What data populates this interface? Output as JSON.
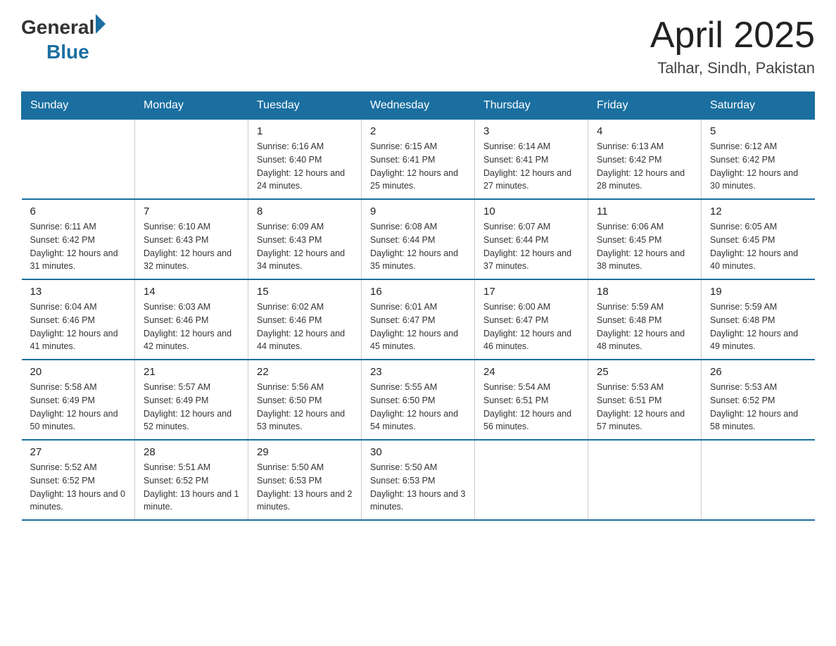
{
  "header": {
    "logo_general": "General",
    "logo_blue": "Blue",
    "title": "April 2025",
    "subtitle": "Talhar, Sindh, Pakistan"
  },
  "calendar": {
    "days_of_week": [
      "Sunday",
      "Monday",
      "Tuesday",
      "Wednesday",
      "Thursday",
      "Friday",
      "Saturday"
    ],
    "weeks": [
      [
        {
          "day": "",
          "info": ""
        },
        {
          "day": "",
          "info": ""
        },
        {
          "day": "1",
          "info": "Sunrise: 6:16 AM\nSunset: 6:40 PM\nDaylight: 12 hours\nand 24 minutes."
        },
        {
          "day": "2",
          "info": "Sunrise: 6:15 AM\nSunset: 6:41 PM\nDaylight: 12 hours\nand 25 minutes."
        },
        {
          "day": "3",
          "info": "Sunrise: 6:14 AM\nSunset: 6:41 PM\nDaylight: 12 hours\nand 27 minutes."
        },
        {
          "day": "4",
          "info": "Sunrise: 6:13 AM\nSunset: 6:42 PM\nDaylight: 12 hours\nand 28 minutes."
        },
        {
          "day": "5",
          "info": "Sunrise: 6:12 AM\nSunset: 6:42 PM\nDaylight: 12 hours\nand 30 minutes."
        }
      ],
      [
        {
          "day": "6",
          "info": "Sunrise: 6:11 AM\nSunset: 6:42 PM\nDaylight: 12 hours\nand 31 minutes."
        },
        {
          "day": "7",
          "info": "Sunrise: 6:10 AM\nSunset: 6:43 PM\nDaylight: 12 hours\nand 32 minutes."
        },
        {
          "day": "8",
          "info": "Sunrise: 6:09 AM\nSunset: 6:43 PM\nDaylight: 12 hours\nand 34 minutes."
        },
        {
          "day": "9",
          "info": "Sunrise: 6:08 AM\nSunset: 6:44 PM\nDaylight: 12 hours\nand 35 minutes."
        },
        {
          "day": "10",
          "info": "Sunrise: 6:07 AM\nSunset: 6:44 PM\nDaylight: 12 hours\nand 37 minutes."
        },
        {
          "day": "11",
          "info": "Sunrise: 6:06 AM\nSunset: 6:45 PM\nDaylight: 12 hours\nand 38 minutes."
        },
        {
          "day": "12",
          "info": "Sunrise: 6:05 AM\nSunset: 6:45 PM\nDaylight: 12 hours\nand 40 minutes."
        }
      ],
      [
        {
          "day": "13",
          "info": "Sunrise: 6:04 AM\nSunset: 6:46 PM\nDaylight: 12 hours\nand 41 minutes."
        },
        {
          "day": "14",
          "info": "Sunrise: 6:03 AM\nSunset: 6:46 PM\nDaylight: 12 hours\nand 42 minutes."
        },
        {
          "day": "15",
          "info": "Sunrise: 6:02 AM\nSunset: 6:46 PM\nDaylight: 12 hours\nand 44 minutes."
        },
        {
          "day": "16",
          "info": "Sunrise: 6:01 AM\nSunset: 6:47 PM\nDaylight: 12 hours\nand 45 minutes."
        },
        {
          "day": "17",
          "info": "Sunrise: 6:00 AM\nSunset: 6:47 PM\nDaylight: 12 hours\nand 46 minutes."
        },
        {
          "day": "18",
          "info": "Sunrise: 5:59 AM\nSunset: 6:48 PM\nDaylight: 12 hours\nand 48 minutes."
        },
        {
          "day": "19",
          "info": "Sunrise: 5:59 AM\nSunset: 6:48 PM\nDaylight: 12 hours\nand 49 minutes."
        }
      ],
      [
        {
          "day": "20",
          "info": "Sunrise: 5:58 AM\nSunset: 6:49 PM\nDaylight: 12 hours\nand 50 minutes."
        },
        {
          "day": "21",
          "info": "Sunrise: 5:57 AM\nSunset: 6:49 PM\nDaylight: 12 hours\nand 52 minutes."
        },
        {
          "day": "22",
          "info": "Sunrise: 5:56 AM\nSunset: 6:50 PM\nDaylight: 12 hours\nand 53 minutes."
        },
        {
          "day": "23",
          "info": "Sunrise: 5:55 AM\nSunset: 6:50 PM\nDaylight: 12 hours\nand 54 minutes."
        },
        {
          "day": "24",
          "info": "Sunrise: 5:54 AM\nSunset: 6:51 PM\nDaylight: 12 hours\nand 56 minutes."
        },
        {
          "day": "25",
          "info": "Sunrise: 5:53 AM\nSunset: 6:51 PM\nDaylight: 12 hours\nand 57 minutes."
        },
        {
          "day": "26",
          "info": "Sunrise: 5:53 AM\nSunset: 6:52 PM\nDaylight: 12 hours\nand 58 minutes."
        }
      ],
      [
        {
          "day": "27",
          "info": "Sunrise: 5:52 AM\nSunset: 6:52 PM\nDaylight: 13 hours\nand 0 minutes."
        },
        {
          "day": "28",
          "info": "Sunrise: 5:51 AM\nSunset: 6:52 PM\nDaylight: 13 hours\nand 1 minute."
        },
        {
          "day": "29",
          "info": "Sunrise: 5:50 AM\nSunset: 6:53 PM\nDaylight: 13 hours\nand 2 minutes."
        },
        {
          "day": "30",
          "info": "Sunrise: 5:50 AM\nSunset: 6:53 PM\nDaylight: 13 hours\nand 3 minutes."
        },
        {
          "day": "",
          "info": ""
        },
        {
          "day": "",
          "info": ""
        },
        {
          "day": "",
          "info": ""
        }
      ]
    ]
  }
}
